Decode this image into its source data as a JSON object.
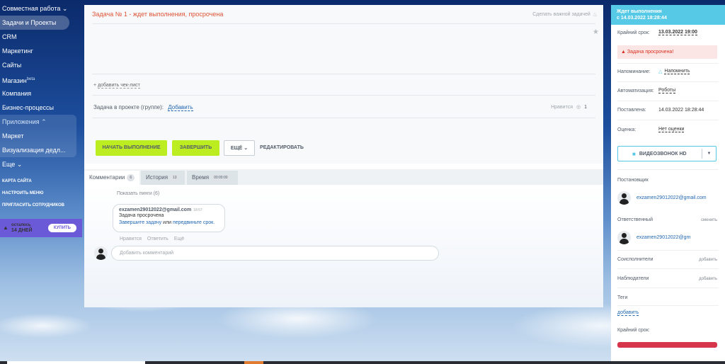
{
  "sidebar": {
    "items": [
      {
        "label": "Совместная работа ⌄"
      },
      {
        "label": "Задачи и Проекты"
      },
      {
        "label": "CRM"
      },
      {
        "label": "Маркетинг"
      },
      {
        "label": "Сайты"
      },
      {
        "label": "Магазин",
        "sup": "beta"
      },
      {
        "label": "Компания"
      },
      {
        "label": "Бизнес-процессы"
      }
    ],
    "apps_group": {
      "head": "Приложения ⌃",
      "items": [
        "Маркет",
        "Визуализация дедл..."
      ]
    },
    "more": "Еще ⌄",
    "links": [
      "КАРТА САЙТА",
      "НАСТРОИТЬ МЕНЮ",
      "ПРИГЛАСИТЬ СОТРУДНИКОВ"
    ],
    "trial": {
      "line1": "осталось",
      "line2": "14 ДНЕЙ",
      "buy": "КУПИТЬ"
    }
  },
  "task": {
    "title": "Задача № 1 - ждет выполнения, просрочена",
    "make_important": "Сделать важной задачей",
    "add_checklist": "добавить чек-лист",
    "project_label": "Задача в проекте (группе):",
    "project_add": "Добавить",
    "like_label": "Нравится",
    "like_count": "1",
    "buttons": {
      "start": "НАЧАТЬ ВЫПОЛНЕНИЕ",
      "finish": "ЗАВЕРШИТЬ",
      "more": "ЕЩЁ",
      "edit": "РЕДАКТИРОВАТЬ"
    }
  },
  "tabs": [
    {
      "label": "Комментарии",
      "badge": "6"
    },
    {
      "label": "История",
      "badge": "13"
    },
    {
      "label": "Время",
      "badge": "00:00:00"
    }
  ],
  "comments": {
    "show_pings": "Показать пинги (6)",
    "author": "exzamen29012022@gmail.com",
    "time": "18:57",
    "line1": "Задача просрочена",
    "link1": "Завершите задачу",
    "or": "или",
    "link2": "передвиньте срок.",
    "actions": [
      "Нравится",
      "Ответить",
      "Ещё"
    ],
    "input_placeholder": "Добавить комментарий"
  },
  "right_panel": {
    "status_line1": "Ждет выполнения",
    "status_line2": "с 14.03.2022 18:28:44",
    "deadline_label": "Крайний срок:",
    "deadline_value": "13.03.2022 19:00",
    "overdue": "Задача просрочена!",
    "reminder_label": "Напоминание:",
    "reminder_value": "Напомнить",
    "automation_label": "Автоматизация:",
    "automation_value": "Роботы",
    "created_label": "Поставлена:",
    "created_value": "14.03.2022 18:28:44",
    "rating_label": "Оценка:",
    "rating_value": "Нет оценки",
    "video_button": "ВИДЕОЗВОНОК HD",
    "creator_title": "Постановщик",
    "creator_email": "exzamen29012022@gmail.com",
    "responsible_title": "Ответственный",
    "responsible_change": "сменить",
    "responsible_email": "exzamen29012022@gm",
    "coexecutors_title": "Соисполнители",
    "coexecutors_add": "добавить",
    "observers_title": "Наблюдатели",
    "observers_add": "добавить",
    "tags_title": "Теги",
    "tags_add": "добавить",
    "deadline2_title": "Крайний срок:"
  },
  "colors": {
    "accent_green": "#bbed21",
    "status_blue": "#56c9e6",
    "overdue_red": "#e05338",
    "trial_purple": "#6b5ad8"
  }
}
